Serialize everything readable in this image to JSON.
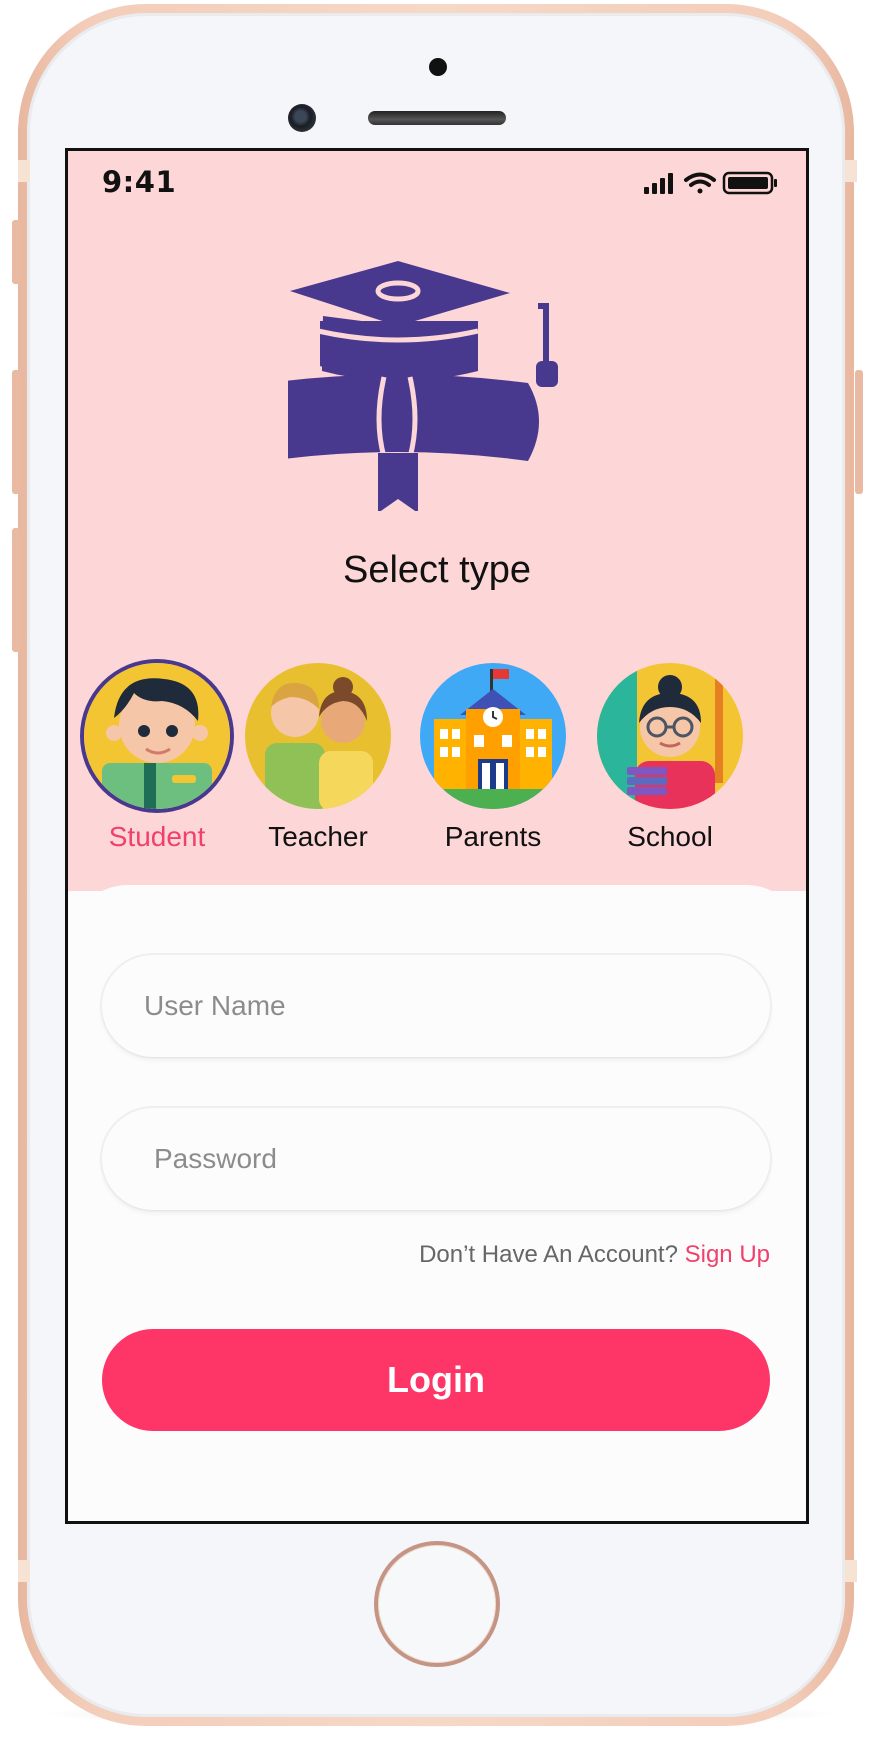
{
  "status_bar": {
    "time": "9:41",
    "signal_icon": "signal-bars-icon",
    "wifi_icon": "wifi-icon",
    "battery_icon": "battery-icon"
  },
  "header": {
    "title": "Select type",
    "logo_icon": "graduation-cap-diploma-icon"
  },
  "user_types": [
    {
      "label": "Student",
      "selected": true,
      "icon": "student-avatar-icon"
    },
    {
      "label": "Teacher",
      "selected": false,
      "icon": "teacher-avatar-icon"
    },
    {
      "label": "Parents",
      "selected": false,
      "icon": "school-building-icon"
    },
    {
      "label": "School",
      "selected": false,
      "icon": "school-teacher-avatar-icon"
    }
  ],
  "form": {
    "username": {
      "placeholder": "User Name",
      "value": ""
    },
    "password": {
      "placeholder": "Password",
      "value": ""
    },
    "signup_prompt": "Don’t Have An Account?",
    "signup_link": "Sign Up",
    "login_label": "Login"
  },
  "colors": {
    "accent": "#fe3567",
    "header_bg": "#fdd6d7",
    "icon_primary": "#48398f",
    "selected_label": "#f0406b"
  }
}
